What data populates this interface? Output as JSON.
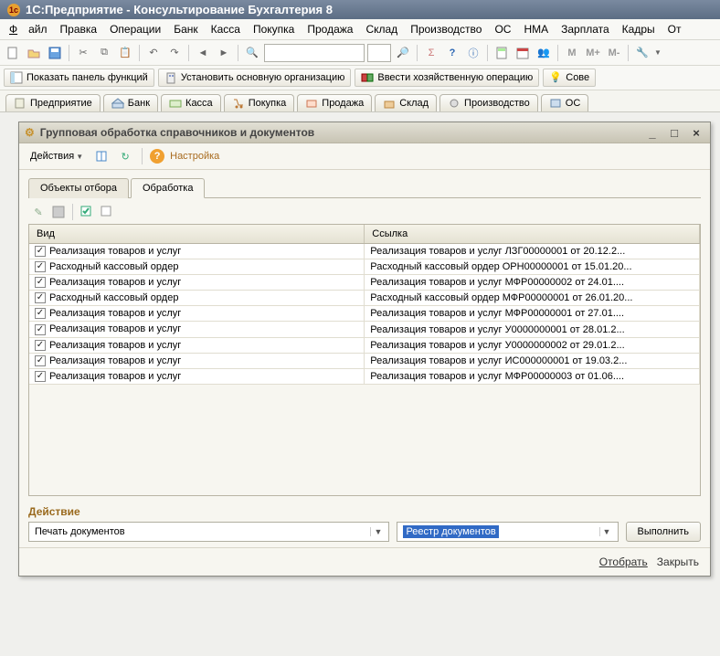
{
  "app": {
    "title": "1С:Предприятие - Консультирование Бухгалтерия 8"
  },
  "menu": {
    "file": "Файл",
    "edit": "Правка",
    "operations": "Операции",
    "bank": "Банк",
    "cash": "Касса",
    "purchase": "Покупка",
    "sale": "Продажа",
    "warehouse": "Склад",
    "production": "Производство",
    "os": "ОС",
    "nma": "НМА",
    "salary": "Зарплата",
    "personnel": "Кадры",
    "reports": "От"
  },
  "toolbar2": {
    "m": "M",
    "mplus": "M+",
    "mminus": "M-"
  },
  "funcbar": {
    "show_panel": "Показать панель функций",
    "set_org": "Установить основную организацию",
    "enter_op": "Ввести хозяйственную операцию",
    "tips": "Сове"
  },
  "section_tabs": {
    "ent": "Предприятие",
    "bank": "Банк",
    "cash": "Касса",
    "purchase": "Покупка",
    "sale": "Продажа",
    "warehouse": "Склад",
    "production": "Производство",
    "os": "ОС"
  },
  "dialog": {
    "title": "Групповая обработка справочников и документов",
    "actions_btn": "Действия",
    "settings": "Настройка",
    "tabs": {
      "objects": "Объекты отбора",
      "process": "Обработка"
    },
    "table": {
      "col_type": "Вид",
      "col_link": "Ссылка",
      "rows": [
        {
          "t": "Реализация товаров и услуг",
          "l": "Реализация товаров и услуг ЛЗГ00000001 от 20.12.2..."
        },
        {
          "t": "Расходный кассовый ордер",
          "l": "Расходный кассовый ордер ОРН00000001 от 15.01.20..."
        },
        {
          "t": "Реализация товаров и услуг",
          "l": "Реализация товаров и услуг МФР00000002 от 24.01...."
        },
        {
          "t": "Расходный кассовый ордер",
          "l": "Расходный кассовый ордер МФР00000001 от 26.01.20..."
        },
        {
          "t": "Реализация товаров и услуг",
          "l": "Реализация товаров и услуг МФР00000001 от 27.01...."
        },
        {
          "t": "Реализация товаров и услуг",
          "l": "Реализация товаров и услуг У0000000001 от 28.01.2..."
        },
        {
          "t": "Реализация товаров и услуг",
          "l": "Реализация товаров и услуг У0000000002 от 29.01.2..."
        },
        {
          "t": "Реализация товаров и услуг",
          "l": "Реализация товаров и услуг ИС000000001 от 19.03.2..."
        },
        {
          "t": "Реализация товаров и услуг",
          "l": "Реализация товаров и услуг МФР00000003 от 01.06...."
        }
      ]
    },
    "action_label": "Действие",
    "action_combo1": "Печать документов",
    "action_combo2": "Реестр документов",
    "execute": "Выполнить",
    "footer_select": "Отобрать",
    "footer_close": "Закрыть"
  }
}
